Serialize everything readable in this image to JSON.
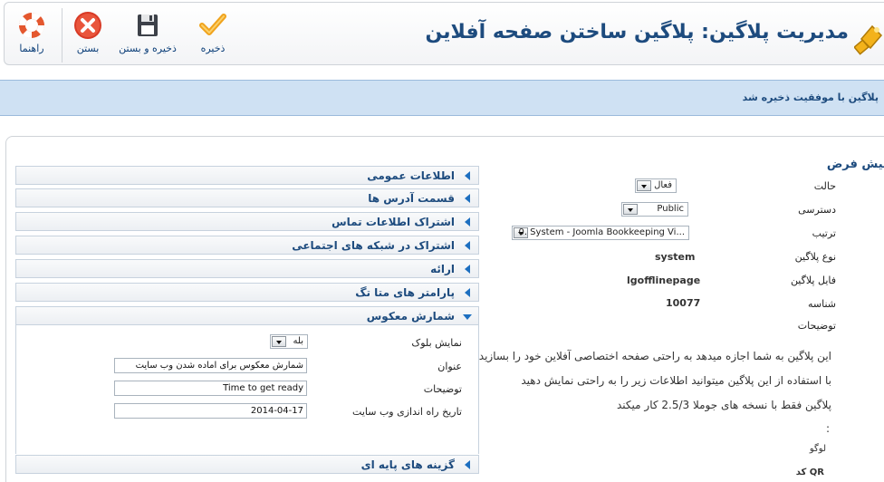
{
  "toolbar": {
    "save_label": "ذخیره",
    "save_close_label": "ذخیره و بستن",
    "close_label": "بستن",
    "help_label": "راهنما"
  },
  "header": {
    "title": "مدیریت پلاگین: پلاگین ساختن صفحه آفلاین"
  },
  "message": {
    "text": "پلاگین با موفقیت ذخیره شد"
  },
  "colors": {
    "accent": "#1d4b7e",
    "message_bg": "#cfe1f3",
    "save_check": "#f0a31d",
    "close_red": "#d83a26"
  },
  "accordion": {
    "items": [
      {
        "label": "اطلاعات عمومی"
      },
      {
        "label": "قسمت آدرس ها"
      },
      {
        "label": "اشتراک اطلاعات تماس"
      },
      {
        "label": "اشتراک در شبکه های اجتماعی"
      },
      {
        "label": "ارائه"
      },
      {
        "label": "پارامتر های متا تگ"
      },
      {
        "label": "شمارش معکوس"
      },
      {
        "label": "گزینه های پایه ای"
      }
    ],
    "countdown": {
      "show_block_label": "نمایش بلوک",
      "show_block_value": "بله",
      "title_label": "عنوان",
      "title_value": "شمارش معکوس برای آماده شدن وب سایت",
      "description_label": "توضیحات",
      "description_value": "Time to get ready",
      "launch_date_label": "تاریخ راه اندازی وب سایت",
      "launch_date_value": "2014-04-17"
    }
  },
  "details": {
    "heading": "پیش فرض",
    "status_label": "حالت",
    "status_value": "فعال",
    "access_label": "دسترسی",
    "access_value": "Public",
    "order_label": "ترتیب",
    "order_value": "0. System - Joomla Bookkeeping Vi...",
    "plugin_type_label": "نوع پلاگین",
    "plugin_type_value": "system",
    "plugin_file_label": "فایل پلاگین",
    "plugin_file_value": "lgofflinepage",
    "id_label": "شناسه",
    "id_value": "10077",
    "description_label": "توضیحات",
    "description_lines": [
      "این پلاگین به شما اجازه میدهد به راحتی صفحه اختصاصی آفلاین خود را بسازید",
      "با استفاده از این پلاگین میتوانید اطلاعات زیر را به راحتی نمایش دهید",
      "پلاگین فقط با نسخه های جوملا 2.5/3 کار میکند",
      ":",
      "لوگو",
      "QR کد"
    ]
  }
}
